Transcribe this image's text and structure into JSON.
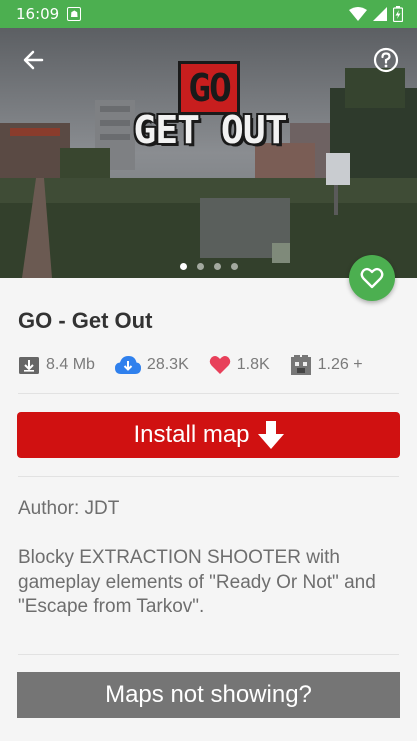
{
  "status_bar": {
    "time": "16:09",
    "notification_icon": "android-notification-icon",
    "icons": [
      "wifi-icon",
      "signal-icon",
      "battery-charging-icon"
    ]
  },
  "hero": {
    "logo_top": "GO",
    "logo_bottom": "GET OUT",
    "back_icon": "arrow-left-icon",
    "help_icon": "help-circle-icon",
    "page_count": 4,
    "active_page": 1
  },
  "map": {
    "title": "GO - Get Out",
    "favorite_icon": "heart-outline-icon",
    "stats": {
      "size": "8.4 Mb",
      "downloads": "28.3K",
      "likes": "1.8K",
      "version": "1.26 +"
    },
    "author": "Author: JDT",
    "description": "Blocky EXTRACTION SHOOTER with gameplay elements of \"Ready Or Not\" and \"Escape from Tarkov\"."
  },
  "actions": {
    "install_label": "Install map",
    "install_icon": "arrow-down-icon",
    "maps_not_showing_label": "Maps not showing?"
  },
  "colors": {
    "status_bar": "#4caf50",
    "fab": "#4caf50",
    "install_button": "#d01111",
    "secondary_button": "#757575",
    "downloads_icon": "#2f80ed",
    "likes_icon": "#e8405a"
  }
}
